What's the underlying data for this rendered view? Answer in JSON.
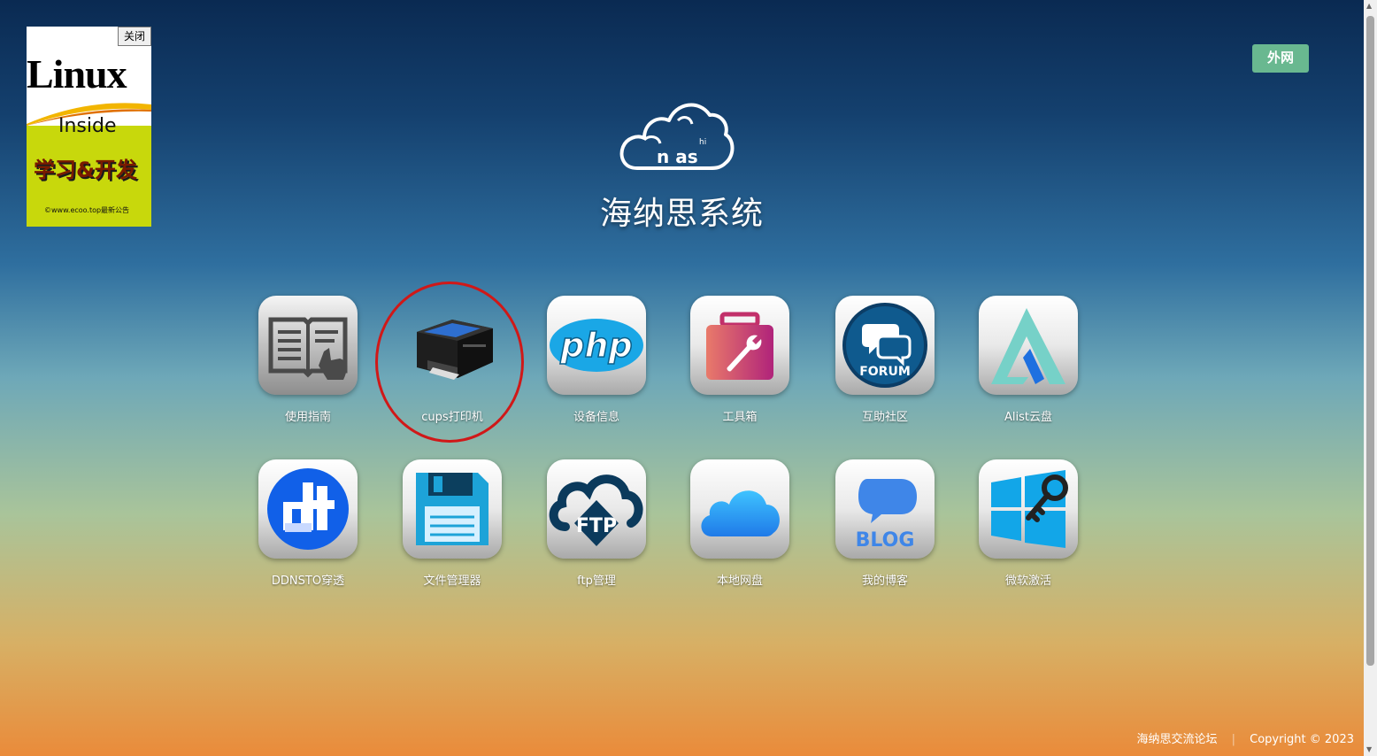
{
  "ad": {
    "close_label": "关闭",
    "brand": "Linux",
    "inside": "Inside",
    "slogan": "学习&开发",
    "notice": "©www.ecoo.top最新公告"
  },
  "network_badge": "外网",
  "logo": {
    "sup": "hi",
    "text": "n as"
  },
  "title": "海纳思系统",
  "apps": [
    {
      "label": "使用指南",
      "icon": "book-icon"
    },
    {
      "label": "cups打印机",
      "icon": "printer-icon",
      "highlighted": true
    },
    {
      "label": "设备信息",
      "icon": "php-icon",
      "icon_text": "php"
    },
    {
      "label": "工具箱",
      "icon": "toolbox-icon"
    },
    {
      "label": "互助社区",
      "icon": "forum-icon",
      "icon_text": "FORUM"
    },
    {
      "label": "Alist云盘",
      "icon": "alist-icon"
    },
    {
      "label": "DDNSTO穿透",
      "icon": "ddnsto-icon"
    },
    {
      "label": "文件管理器",
      "icon": "floppy-disk-icon"
    },
    {
      "label": "ftp管理",
      "icon": "ftp-cloud-icon",
      "icon_text": "FTP"
    },
    {
      "label": "本地网盘",
      "icon": "icloud-icon"
    },
    {
      "label": "我的博客",
      "icon": "blog-icon",
      "icon_text": "BLOG"
    },
    {
      "label": "微软激活",
      "icon": "windows-key-icon"
    }
  ],
  "highlight_color": "#d01818",
  "footer": {
    "forum_link": "海纳思交流论坛",
    "copyright": "Copyright © 2023"
  }
}
